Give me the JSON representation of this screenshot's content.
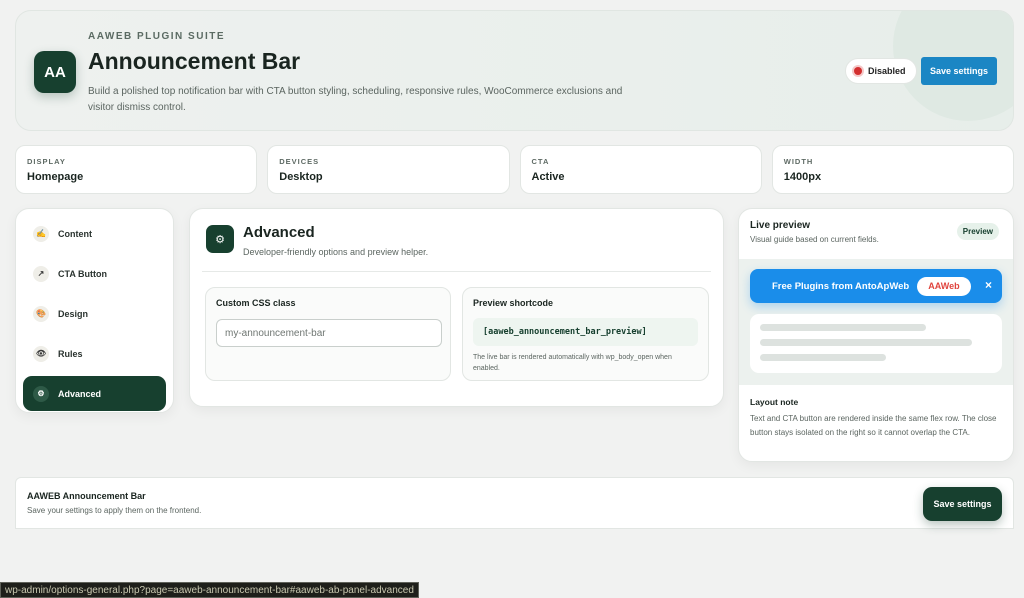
{
  "header": {
    "logo_text": "AA",
    "eyebrow": "AAWEB PLUGIN SUITE",
    "title": "Announcement Bar",
    "description": "Build a polished top notification bar with CTA button styling, scheduling, responsive rules, WooCommerce exclusions and visitor dismiss control.",
    "status_label": "Disabled",
    "status_color": "#d32f2f",
    "save_label": "Save settings"
  },
  "stats": [
    {
      "label": "DISPLAY",
      "value": "Homepage"
    },
    {
      "label": "DEVICES",
      "value": "Desktop"
    },
    {
      "label": "CTA",
      "value": "Active"
    },
    {
      "label": "WIDTH",
      "value": "1400px"
    }
  ],
  "sidebar": {
    "items": [
      {
        "label": "Content",
        "icon": "pencil-icon",
        "glyph": "✍"
      },
      {
        "label": "CTA Button",
        "icon": "arrow-icon",
        "glyph": "↗"
      },
      {
        "label": "Design",
        "icon": "palette-icon",
        "glyph": "🎨"
      },
      {
        "label": "Rules",
        "icon": "eye-icon",
        "glyph": "👁"
      },
      {
        "label": "Advanced",
        "icon": "gear-icon",
        "glyph": "⚙",
        "active": true
      }
    ]
  },
  "panel": {
    "icon_glyph": "⚙",
    "title": "Advanced",
    "subtitle": "Developer-friendly options and preview helper.",
    "css_class": {
      "label": "Custom CSS class",
      "placeholder": "my-announcement-bar",
      "value": ""
    },
    "shortcode": {
      "label": "Preview shortcode",
      "code": "[aaweb_announcement_bar_preview]",
      "note": "The live bar is rendered automatically with wp_body_open when enabled."
    }
  },
  "preview": {
    "title": "Live preview",
    "subtitle": "Visual guide based on current fields.",
    "badge": "Preview",
    "bar_text": "Free Plugins from AntoApWeb",
    "bar_cta": "AAWeb",
    "bar_close": "×",
    "bar_color": "#1a8dea",
    "cta_text_color": "#e0443e",
    "note_title": "Layout note",
    "note_text": "Text and CTA button are rendered inside the same flex row. The close button stays isolated on the right so it cannot overlap the CTA."
  },
  "footer": {
    "title": "AAWEB Announcement Bar",
    "subtitle": "Save your settings to apply them on the frontend.",
    "save_label": "Save settings"
  },
  "statusbar": {
    "url": "wp-admin/options-general.php?page=aaweb-announcement-bar#aaweb-ab-panel-advanced"
  },
  "colors": {
    "accent_dark": "#17402f",
    "accent_blue": "#1b86c4"
  }
}
